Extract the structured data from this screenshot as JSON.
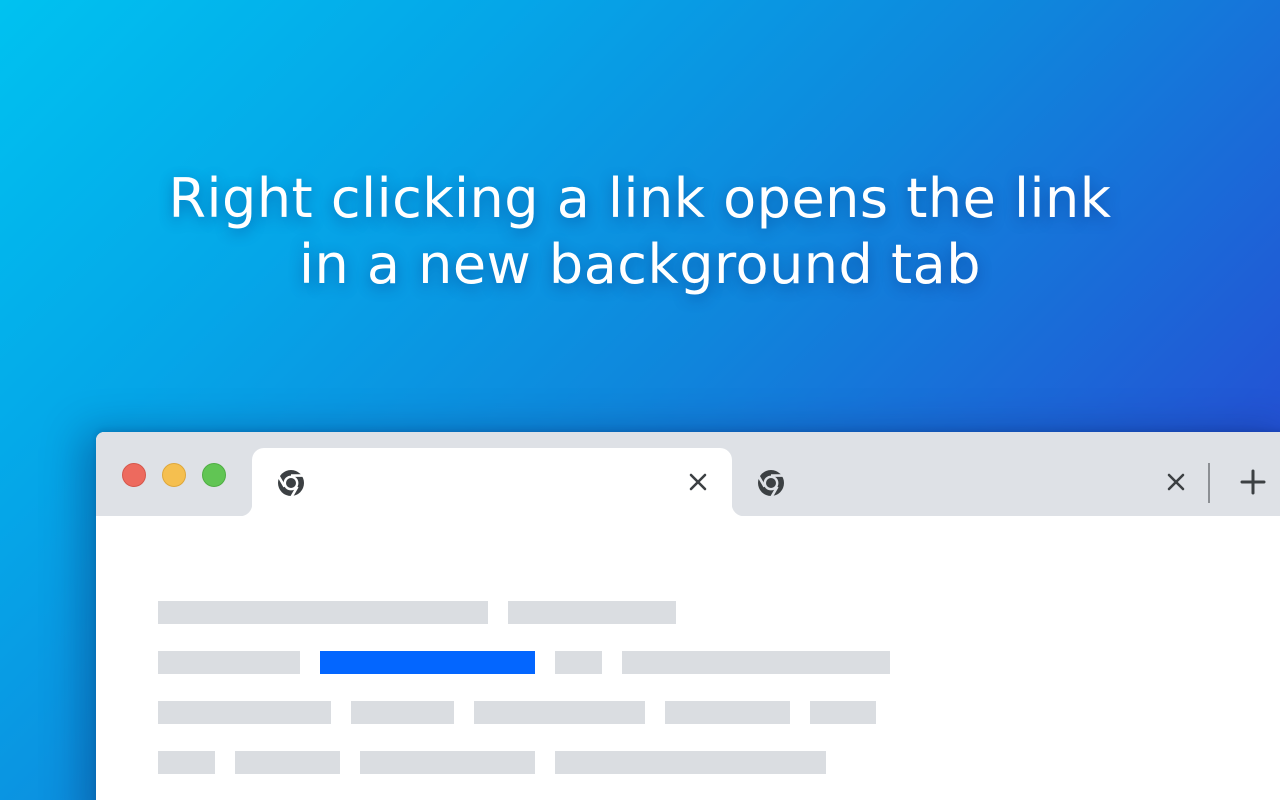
{
  "headline": {
    "line1": "Right clicking a link opens the link",
    "line2": "in a new background tab"
  },
  "browser": {
    "window_controls": [
      "close",
      "minimize",
      "maximize"
    ],
    "tabs": [
      {
        "state": "active",
        "icon": "chrome-icon",
        "close_icon": "close-icon"
      },
      {
        "state": "background",
        "icon": "chrome-icon",
        "close_icon": "close-icon"
      }
    ],
    "new_tab_icon": "plus-icon"
  },
  "page": {
    "placeholder_text_lines": 4,
    "highlighted_link": {
      "line": 2,
      "word": 2
    }
  },
  "colors": {
    "background_gradient_start": "#00c2f0",
    "background_gradient_end": "#2e35cf",
    "titlebar": "#dee1e6",
    "placeholder_bar": "#dadde1",
    "link_highlight": "#0366ff",
    "traffic_close": "#ed6a5e",
    "traffic_minimize": "#f5bf4f",
    "traffic_maximize": "#61c554"
  }
}
